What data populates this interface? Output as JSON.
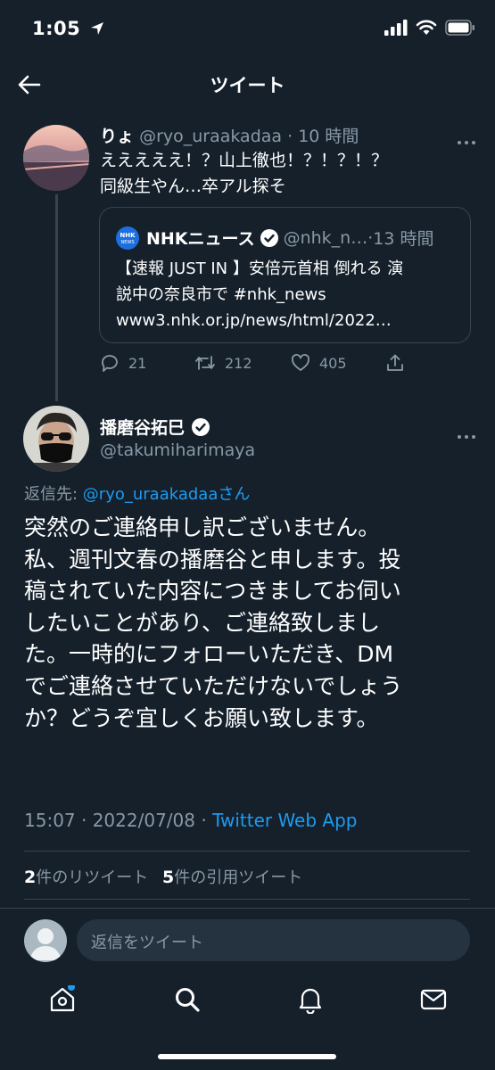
{
  "status_bar": {
    "time": "1:05"
  },
  "header": {
    "title": "ツイート"
  },
  "tweet1": {
    "name": "りょ",
    "handle": "@ryo_uraakadaa",
    "sep": "·",
    "time": "10 時間",
    "lines": [
      "えええええ！？山上徹也！？！？！？",
      "同級生やん…卒アル探そ"
    ]
  },
  "quote": {
    "name": "NHKニュース",
    "handle": "@nhk_n…",
    "sep": "·",
    "time": "13 時間",
    "logo_text": "NHK NEWS",
    "lines": [
      "【速報 JUST IN 】安倍元首相 倒れる 演",
      "説中の奈良市で #nhk_news",
      "www3.nhk.or.jp/news/html/2022…"
    ]
  },
  "actions": {
    "replies": "21",
    "retweets": "212",
    "likes": "405"
  },
  "tweet2": {
    "name": "播磨谷拓巳",
    "handle": "@takumiharimaya",
    "reply_prefix": "返信先: ",
    "reply_user": "@ryo_uraakadaa",
    "reply_suffix": "さん",
    "lines": [
      "突然のご連絡申し訳ございません。",
      "私、週刊文春の播磨谷と申します。投",
      "稿されていた内容につきましてお伺い",
      "したいことがあり、ご連絡致しまし",
      "た。一時的にフォローいただき、DM",
      "でご連絡させていただけないでしょう",
      "か？どうぞ宜しくお願い致します。"
    ],
    "timestamp": "15:07 · 2022/07/08 · ",
    "source": "Twitter Web App",
    "retweet_count": "2",
    "retweet_label": "件のリツイート",
    "quote_count": "5",
    "quote_label": "件の引用ツイート"
  },
  "reply_box": {
    "placeholder": "返信をツイート"
  },
  "colors": {
    "background": "#15202b",
    "accent": "#1d9bf0",
    "muted": "#8899a6",
    "border": "#38444d"
  },
  "icons": [
    "location-arrow-icon",
    "signal-icon",
    "wifi-icon",
    "battery-icon",
    "back-arrow-icon",
    "more-icon",
    "verified-icon",
    "reply-icon",
    "retweet-icon",
    "like-icon",
    "share-icon",
    "home-icon",
    "search-icon",
    "notifications-icon",
    "messages-icon"
  ]
}
